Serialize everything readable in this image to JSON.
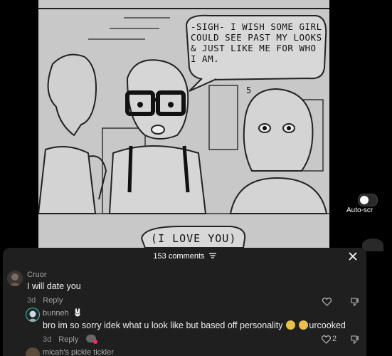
{
  "video": {
    "speech_bubble": "-SIGH- I WISH SOME GIRL COULD SEE PAST MY LOOKS & JUST LIKE ME FOR WHO I AM.",
    "caption": "(I LOVE YOU)",
    "panel_number": "5"
  },
  "side": {
    "autoscroll_label": "Auto-scr"
  },
  "comments_panel": {
    "count_label": "153 comments",
    "comments": [
      {
        "username": "Cruor",
        "text": "I will date you",
        "age": "3d",
        "reply_label": "Reply"
      },
      {
        "username": "bunneh",
        "text": "bro im so sorry idek what u look like but based off personality",
        "trailing_text": "urcooked",
        "age": "3d",
        "reply_label": "Reply",
        "likes": "2"
      },
      {
        "username": "micah's pickle tickler"
      }
    ]
  },
  "colors": {
    "sheet_bg": "#1f1f1f",
    "page_bg": "#000000",
    "username": "#a9a9a9",
    "meta": "#8a8a8a"
  }
}
